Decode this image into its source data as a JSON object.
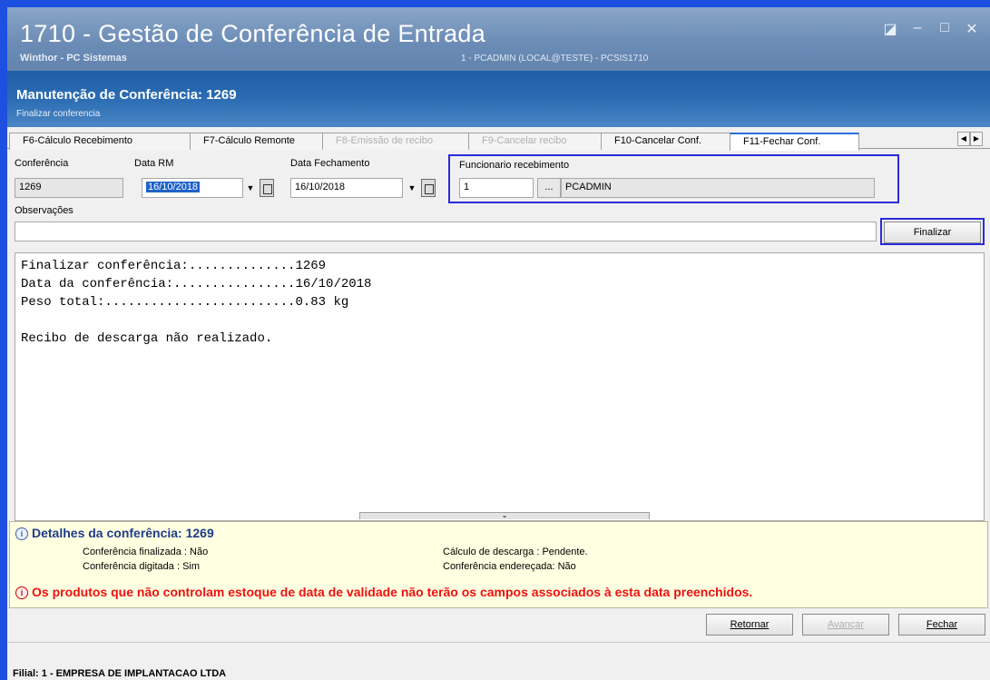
{
  "window": {
    "title": "1710 - Gestão de Conferência de Entrada",
    "subtitle": "Winthor - PC Sistemas",
    "session": "1 - PCADMIN (LOCAL@TESTE) - PCSIS1710",
    "controls": {
      "restore": "◪",
      "minimize": "–",
      "maximize": "□",
      "close": "✕"
    }
  },
  "header": {
    "title": "Manutenção de Conferência: 1269",
    "subtitle": "Finalizar conferencia"
  },
  "tabs": [
    {
      "label": "F6-Cálculo Recebimento",
      "enabled": true
    },
    {
      "label": "F7-Cálculo Remonte",
      "enabled": true
    },
    {
      "label": "F8-Emissão de recibo",
      "enabled": false
    },
    {
      "label": "F9-Cancelar recibo",
      "enabled": false
    },
    {
      "label": "F10-Cancelar Conf.",
      "enabled": true
    },
    {
      "label": "F11-Fechar Conf.",
      "enabled": true,
      "active": true
    }
  ],
  "tab_nav": {
    "prev": "◀",
    "next": "▶"
  },
  "form": {
    "conferencia_label": "Conferência",
    "conferencia_value": "1269",
    "data_rm_label": "Data RM",
    "data_rm_value": "16/10/2018",
    "data_fechamento_label": "Data Fechamento",
    "data_fechamento_value": "16/10/2018",
    "funcionario_label": "Funcionario recebimento",
    "funcionario_code": "1",
    "funcionario_lookup": "...",
    "funcionario_name": "PCADMIN",
    "observacoes_label": "Observações",
    "observacoes_value": "",
    "dropdown_glyph": "▼",
    "finalizar_label": "Finalizar"
  },
  "log_lines": [
    "Finalizar conferência:..............1269",
    "Data da conferência:................16/10/2018",
    "Peso total:.........................0.83 kg",
    "",
    "Recibo de descarga não realizado."
  ],
  "splitter_glyph": "⌄",
  "details": {
    "icon": "i",
    "title": "Detalhes da conferência: 1269",
    "finalizada": "Conferência finalizada : Não",
    "digitada": "Conferência digitada : Sim",
    "calculo": "Cálculo de descarga : Pendente.",
    "enderecada": "Conferência endereçada: Não",
    "warning": "Os produtos que não controlam estoque de data de validade não terão os campos associados à esta data preenchidos."
  },
  "buttons": {
    "retornar": "Retornar",
    "avancar": "Avançar",
    "fechar": "Fechar"
  },
  "status": {
    "filial": "Filial: 1 - EMPRESA DE IMPLANTACAO LTDA"
  }
}
